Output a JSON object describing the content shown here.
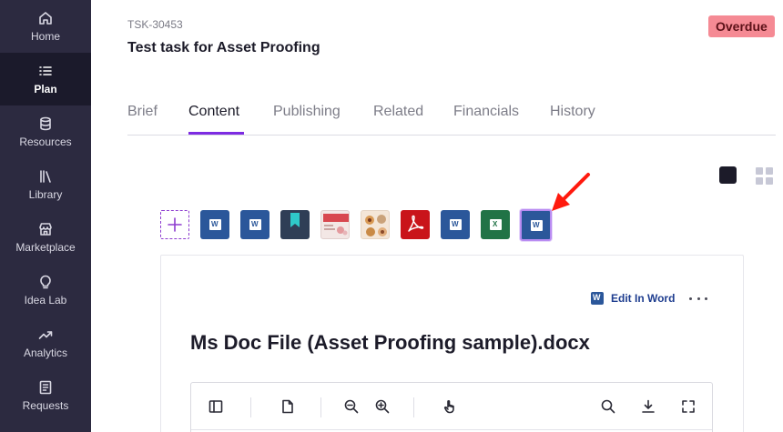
{
  "sidebar": {
    "items": [
      {
        "label": "Home",
        "icon": "home-icon",
        "active": false
      },
      {
        "label": "Plan",
        "icon": "list-icon",
        "active": true
      },
      {
        "label": "Resources",
        "icon": "database-icon",
        "active": false
      },
      {
        "label": "Library",
        "icon": "library-icon",
        "active": false
      },
      {
        "label": "Marketplace",
        "icon": "store-icon",
        "active": false
      },
      {
        "label": "Idea Lab",
        "icon": "lightbulb-icon",
        "active": false
      },
      {
        "label": "Analytics",
        "icon": "trend-icon",
        "active": false
      },
      {
        "label": "Requests",
        "icon": "requests-icon",
        "active": false
      }
    ]
  },
  "header": {
    "task_id": "TSK-30453",
    "title": "Test task for Asset Proofing",
    "status_badge": "Overdue",
    "status_color": "#f58a94"
  },
  "tabs": [
    {
      "label": "Brief",
      "active": false
    },
    {
      "label": "Content",
      "active": true
    },
    {
      "label": "Publishing",
      "active": false
    },
    {
      "label": "Related",
      "active": false
    },
    {
      "label": "Financials",
      "active": false
    },
    {
      "label": "History",
      "active": false
    }
  ],
  "accent_color": "#7d2be2",
  "assets": [
    {
      "type": "word"
    },
    {
      "type": "word"
    },
    {
      "type": "bookmark"
    },
    {
      "type": "image"
    },
    {
      "type": "image"
    },
    {
      "type": "pdf"
    },
    {
      "type": "word"
    },
    {
      "type": "excel"
    },
    {
      "type": "word",
      "selected": true
    }
  ],
  "content": {
    "edit_label": "Edit In Word",
    "doc_title": "Ms Doc File (Asset Proofing sample).docx"
  }
}
